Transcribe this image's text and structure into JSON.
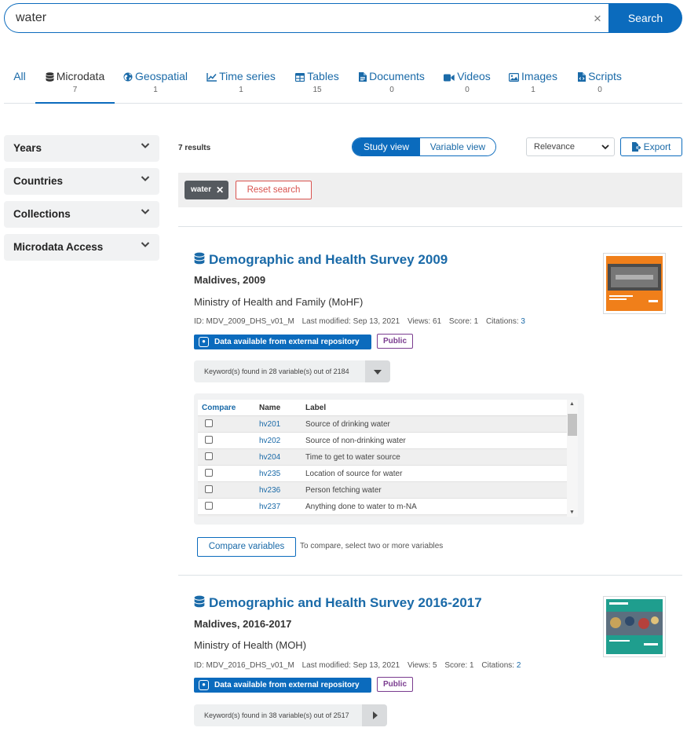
{
  "search": {
    "value": "water",
    "button_label": "Search",
    "clear_symbol": "×"
  },
  "tabs": [
    {
      "label": "All",
      "count": "",
      "icon": "none",
      "active": false
    },
    {
      "label": "Microdata",
      "count": "7",
      "icon": "database-icon",
      "active": true
    },
    {
      "label": "Geospatial",
      "count": "1",
      "icon": "globe-icon",
      "active": false
    },
    {
      "label": "Time series",
      "count": "1",
      "icon": "line-chart-icon",
      "active": false
    },
    {
      "label": "Tables",
      "count": "15",
      "icon": "table-icon",
      "active": false
    },
    {
      "label": "Documents",
      "count": "0",
      "icon": "document-icon",
      "active": false
    },
    {
      "label": "Videos",
      "count": "0",
      "icon": "video-icon",
      "active": false
    },
    {
      "label": "Images",
      "count": "1",
      "icon": "image-icon",
      "active": false
    },
    {
      "label": "Scripts",
      "count": "0",
      "icon": "script-icon",
      "active": false
    }
  ],
  "facets": [
    "Years",
    "Countries",
    "Collections",
    "Microdata Access"
  ],
  "results": {
    "count_label": "7 results",
    "view_toggle": {
      "study": "Study view",
      "variable": "Variable view",
      "active": "study"
    },
    "sort": {
      "selected": "Relevance"
    },
    "export_label": "Export",
    "active_filter": {
      "label": "water",
      "remove_symbol": "✕"
    },
    "reset_label": "Reset search"
  },
  "studies": [
    {
      "title": "Demographic and Health Survey 2009",
      "subtitle": "Maldives, 2009",
      "organization": "Ministry of Health and Family (MoHF)",
      "id": "ID: MDV_2009_DHS_v01_M",
      "modified": "Last modified: Sep 13, 2021",
      "views": "Views: 61",
      "score": "Score: 1",
      "citations_label": "Citations:",
      "citations_count": "3",
      "access_label": "Data available from external repository",
      "license_label": "Public",
      "keyword_summary": "Keyword(s) found in 28 variable(s) out of 2184",
      "keyword_expanded": true,
      "cover_color": "#f07f1a"
    },
    {
      "title": "Demographic and Health Survey 2016-2017",
      "subtitle": "Maldives, 2016-2017",
      "organization": "Ministry of Health (MOH)",
      "id": "ID: MDV_2016_DHS_v01_M",
      "modified": "Last modified: Sep 13, 2021",
      "views": "Views: 5",
      "score": "Score: 1",
      "citations_label": "Citations:",
      "citations_count": "2",
      "access_label": "Data available from external repository",
      "license_label": "Public",
      "keyword_summary": "Keyword(s) found in 38 variable(s) out of 2517",
      "keyword_expanded": false,
      "cover_color": "#1f9e8e"
    }
  ],
  "variables_table": {
    "headers": {
      "compare": "Compare",
      "name": "Name",
      "label": "Label"
    },
    "rows": [
      {
        "name": "hv201",
        "label": "Source of drinking water"
      },
      {
        "name": "hv202",
        "label": "Source of non-drinking water"
      },
      {
        "name": "hv204",
        "label": "Time to get to water source"
      },
      {
        "name": "hv235",
        "label": "Location of source for water"
      },
      {
        "name": "hv236",
        "label": "Person fetching water"
      },
      {
        "name": "hv237",
        "label": "Anything done to water to m-NA"
      }
    ]
  },
  "compare": {
    "button_label": "Compare variables",
    "hint": "To compare, select two or more variables"
  },
  "colors": {
    "primary": "#0b6bbd",
    "link": "#1a6aa8",
    "public": "#7a3c8f",
    "reset": "#d9534f"
  }
}
